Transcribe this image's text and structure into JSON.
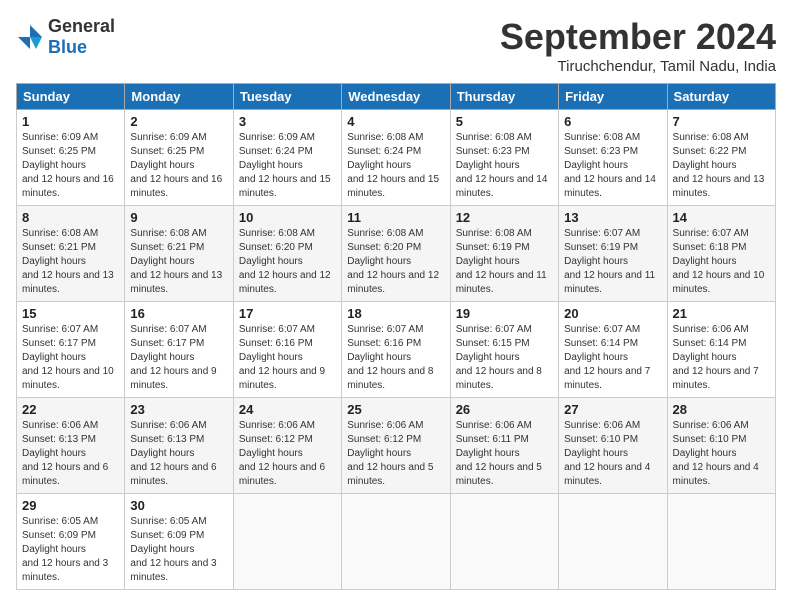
{
  "header": {
    "logo_general": "General",
    "logo_blue": "Blue",
    "month_year": "September 2024",
    "location": "Tiruchchendur, Tamil Nadu, India"
  },
  "days_of_week": [
    "Sunday",
    "Monday",
    "Tuesday",
    "Wednesday",
    "Thursday",
    "Friday",
    "Saturday"
  ],
  "weeks": [
    [
      {
        "day": "1",
        "sunrise": "6:09 AM",
        "sunset": "6:25 PM",
        "daylight": "12 hours and 16 minutes."
      },
      {
        "day": "2",
        "sunrise": "6:09 AM",
        "sunset": "6:25 PM",
        "daylight": "12 hours and 16 minutes."
      },
      {
        "day": "3",
        "sunrise": "6:09 AM",
        "sunset": "6:24 PM",
        "daylight": "12 hours and 15 minutes."
      },
      {
        "day": "4",
        "sunrise": "6:08 AM",
        "sunset": "6:24 PM",
        "daylight": "12 hours and 15 minutes."
      },
      {
        "day": "5",
        "sunrise": "6:08 AM",
        "sunset": "6:23 PM",
        "daylight": "12 hours and 14 minutes."
      },
      {
        "day": "6",
        "sunrise": "6:08 AM",
        "sunset": "6:23 PM",
        "daylight": "12 hours and 14 minutes."
      },
      {
        "day": "7",
        "sunrise": "6:08 AM",
        "sunset": "6:22 PM",
        "daylight": "12 hours and 13 minutes."
      }
    ],
    [
      {
        "day": "8",
        "sunrise": "6:08 AM",
        "sunset": "6:21 PM",
        "daylight": "12 hours and 13 minutes."
      },
      {
        "day": "9",
        "sunrise": "6:08 AM",
        "sunset": "6:21 PM",
        "daylight": "12 hours and 13 minutes."
      },
      {
        "day": "10",
        "sunrise": "6:08 AM",
        "sunset": "6:20 PM",
        "daylight": "12 hours and 12 minutes."
      },
      {
        "day": "11",
        "sunrise": "6:08 AM",
        "sunset": "6:20 PM",
        "daylight": "12 hours and 12 minutes."
      },
      {
        "day": "12",
        "sunrise": "6:08 AM",
        "sunset": "6:19 PM",
        "daylight": "12 hours and 11 minutes."
      },
      {
        "day": "13",
        "sunrise": "6:07 AM",
        "sunset": "6:19 PM",
        "daylight": "12 hours and 11 minutes."
      },
      {
        "day": "14",
        "sunrise": "6:07 AM",
        "sunset": "6:18 PM",
        "daylight": "12 hours and 10 minutes."
      }
    ],
    [
      {
        "day": "15",
        "sunrise": "6:07 AM",
        "sunset": "6:17 PM",
        "daylight": "12 hours and 10 minutes."
      },
      {
        "day": "16",
        "sunrise": "6:07 AM",
        "sunset": "6:17 PM",
        "daylight": "12 hours and 9 minutes."
      },
      {
        "day": "17",
        "sunrise": "6:07 AM",
        "sunset": "6:16 PM",
        "daylight": "12 hours and 9 minutes."
      },
      {
        "day": "18",
        "sunrise": "6:07 AM",
        "sunset": "6:16 PM",
        "daylight": "12 hours and 8 minutes."
      },
      {
        "day": "19",
        "sunrise": "6:07 AM",
        "sunset": "6:15 PM",
        "daylight": "12 hours and 8 minutes."
      },
      {
        "day": "20",
        "sunrise": "6:07 AM",
        "sunset": "6:14 PM",
        "daylight": "12 hours and 7 minutes."
      },
      {
        "day": "21",
        "sunrise": "6:06 AM",
        "sunset": "6:14 PM",
        "daylight": "12 hours and 7 minutes."
      }
    ],
    [
      {
        "day": "22",
        "sunrise": "6:06 AM",
        "sunset": "6:13 PM",
        "daylight": "12 hours and 6 minutes."
      },
      {
        "day": "23",
        "sunrise": "6:06 AM",
        "sunset": "6:13 PM",
        "daylight": "12 hours and 6 minutes."
      },
      {
        "day": "24",
        "sunrise": "6:06 AM",
        "sunset": "6:12 PM",
        "daylight": "12 hours and 6 minutes."
      },
      {
        "day": "25",
        "sunrise": "6:06 AM",
        "sunset": "6:12 PM",
        "daylight": "12 hours and 5 minutes."
      },
      {
        "day": "26",
        "sunrise": "6:06 AM",
        "sunset": "6:11 PM",
        "daylight": "12 hours and 5 minutes."
      },
      {
        "day": "27",
        "sunrise": "6:06 AM",
        "sunset": "6:10 PM",
        "daylight": "12 hours and 4 minutes."
      },
      {
        "day": "28",
        "sunrise": "6:06 AM",
        "sunset": "6:10 PM",
        "daylight": "12 hours and 4 minutes."
      }
    ],
    [
      {
        "day": "29",
        "sunrise": "6:05 AM",
        "sunset": "6:09 PM",
        "daylight": "12 hours and 3 minutes."
      },
      {
        "day": "30",
        "sunrise": "6:05 AM",
        "sunset": "6:09 PM",
        "daylight": "12 hours and 3 minutes."
      },
      null,
      null,
      null,
      null,
      null
    ]
  ]
}
